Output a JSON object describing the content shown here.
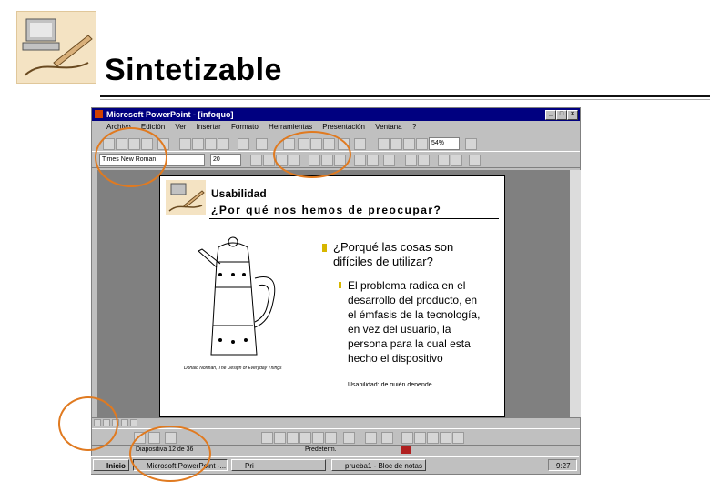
{
  "slide": {
    "title": "Sintetizable"
  },
  "window": {
    "title": "Microsoft PowerPoint - [infoquo]",
    "menu": [
      "Archivo",
      "Edición",
      "Ver",
      "Insertar",
      "Formato",
      "Herramientas",
      "Presentación",
      "Ventana",
      "?"
    ],
    "zoom": "54%",
    "font_name": "Times New Roman",
    "font_size": "20"
  },
  "inner_slide": {
    "heading1": "Usabilidad",
    "heading2": "¿Por qué nos hemos de preocupar?",
    "caption": "Donald Norman, The Design of Everyday Things",
    "bullet": "¿Porqué las cosas son difíciles de utilizar?",
    "sub_bullet": "El problema radica en el desarrollo del producto, en el émfasis de la tecnología, en vez del usuario, la persona para la cual esta hecho el dispositivo",
    "sub_bullet_cut": "Usabilidad: de quién depende"
  },
  "status": {
    "slide_num": "Diapositiva 12 de 36",
    "template": "Predeterm.",
    "spell_icon": "spell-check-icon"
  },
  "taskbar": {
    "start": "Inicio",
    "tasks": [
      "Microsoft PowerPoint -...",
      "Pri",
      "prueba1 - Bloc de notas"
    ],
    "clock": "9:27"
  },
  "colors": {
    "accent_ring": "#e07a20",
    "title_bar": "#000080",
    "bullet": "#d7b600"
  }
}
